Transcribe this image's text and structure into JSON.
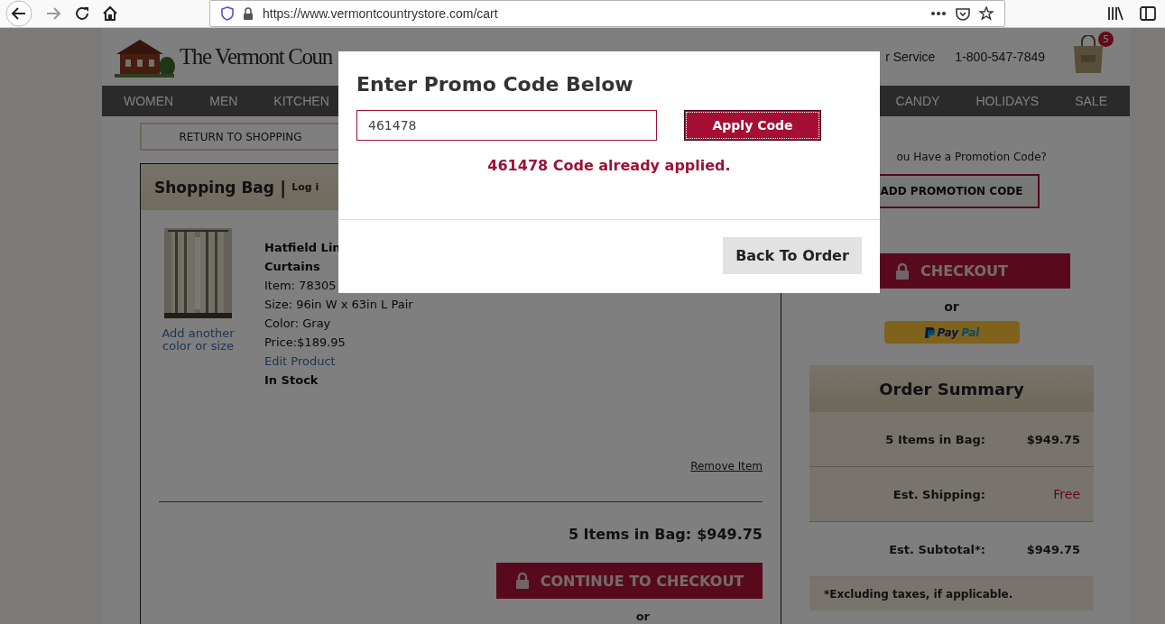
{
  "browser": {
    "url": "https://www.vermontcountrystore.com/cart"
  },
  "header": {
    "logo_text": "The Vermont Coun",
    "service": "r Service",
    "phone": "1-800-547-7849",
    "bag_count": "5"
  },
  "nav": {
    "left": [
      "WOMEN",
      "MEN",
      "KITCHEN"
    ],
    "right": [
      "CANDY",
      "HOLIDAYS",
      "SALE"
    ]
  },
  "cart": {
    "return_button": "RETURN TO SHOPPING",
    "title": "Shopping Bag",
    "separator": "|",
    "login": "Log i",
    "item": {
      "add_link": [
        "Add another",
        "color or size"
      ],
      "name_lines": [
        "Hatfield Lin",
        "Curtains"
      ],
      "details": [
        "Item: 78305",
        "Size: 96in W x 63in L Pair",
        "Color: Gray",
        "Price:$189.95"
      ],
      "edit_link": "Edit Product",
      "stock": "In Stock",
      "remove_link": "Remove Item"
    },
    "total_label": "5 Items in Bag:",
    "total": "$949.75",
    "continue_button": "CONTINUE TO CHECKOUT",
    "or": "or"
  },
  "sidebar": {
    "promo_question": "ou Have a Promotion Code?",
    "promo_button": "ADD PROMOTION CODE",
    "checkout_button": "CHECKOUT",
    "or": "or",
    "paypal": [
      "Pay",
      "Pal"
    ],
    "summary": {
      "title": "Order Summary",
      "rows": [
        {
          "label": "5 Items in Bag:",
          "value": "$949.75",
          "kind": "amount",
          "shaded": true
        },
        {
          "label": "Est. Shipping:",
          "value": "Free",
          "kind": "free",
          "shaded": true
        },
        {
          "label": "Est. Subtotal*:",
          "value": "$949.75",
          "kind": "amount",
          "shaded": false
        }
      ],
      "note": "*Excluding taxes, if applicable."
    }
  },
  "modal": {
    "title": "Enter Promo Code Below",
    "input_value": "461478",
    "apply_button": "Apply Code",
    "message": "461478 Code already applied.",
    "back_button": "Back To Order"
  }
}
